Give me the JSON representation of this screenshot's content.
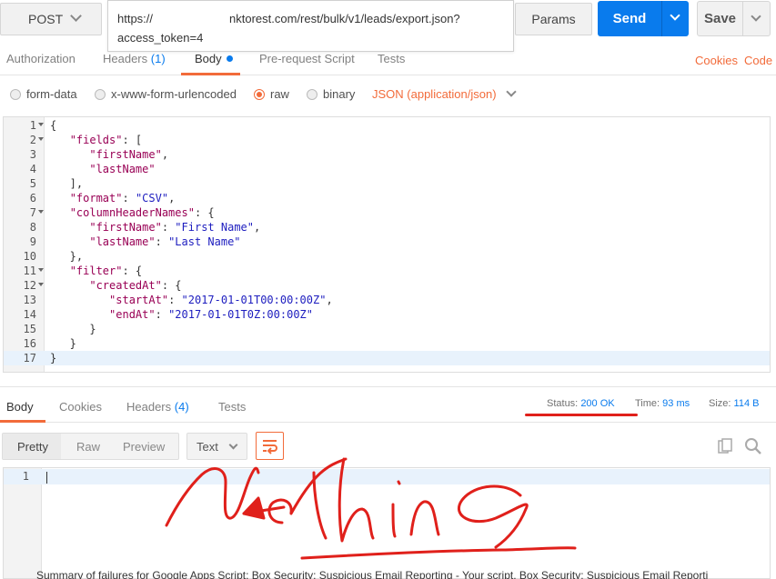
{
  "request": {
    "method": "POST",
    "url_line1_prefix": "https://",
    "url_line1_suffix": "nktorest.com/rest/bulk/v1/leads/export.json?",
    "url_line2": "access_token=4",
    "params_label": "Params",
    "send_label": "Send",
    "save_label": "Save"
  },
  "request_tabs": {
    "authorization": "Authorization",
    "headers": "Headers",
    "headers_count": "(1)",
    "body": "Body",
    "prerequest": "Pre-request Script",
    "tests": "Tests",
    "cookies": "Cookies",
    "code": "Code"
  },
  "body_types": {
    "form_data": "form-data",
    "urlencoded": "x-www-form-urlencoded",
    "raw": "raw",
    "binary": "binary",
    "content_type": "JSON (application/json)",
    "selected": "raw"
  },
  "code_lines": [
    {
      "n": "1",
      "fold": true,
      "parts": [
        [
          "p",
          "{"
        ]
      ]
    },
    {
      "n": "2",
      "fold": true,
      "parts": [
        [
          "p",
          "   "
        ],
        [
          "k",
          "\"fields\""
        ],
        [
          "p",
          ": ["
        ]
      ]
    },
    {
      "n": "3",
      "fold": false,
      "parts": [
        [
          "p",
          "      "
        ],
        [
          "k",
          "\"firstName\""
        ],
        [
          "p",
          ","
        ]
      ]
    },
    {
      "n": "4",
      "fold": false,
      "parts": [
        [
          "p",
          "      "
        ],
        [
          "k",
          "\"lastName\""
        ]
      ]
    },
    {
      "n": "5",
      "fold": false,
      "parts": [
        [
          "p",
          "   ],"
        ]
      ]
    },
    {
      "n": "6",
      "fold": false,
      "parts": [
        [
          "p",
          "   "
        ],
        [
          "k",
          "\"format\""
        ],
        [
          "p",
          ": "
        ],
        [
          "s",
          "\"CSV\""
        ],
        [
          "p",
          ","
        ]
      ]
    },
    {
      "n": "7",
      "fold": true,
      "parts": [
        [
          "p",
          "   "
        ],
        [
          "k",
          "\"columnHeaderNames\""
        ],
        [
          "p",
          ": {"
        ]
      ]
    },
    {
      "n": "8",
      "fold": false,
      "parts": [
        [
          "p",
          "      "
        ],
        [
          "k",
          "\"firstName\""
        ],
        [
          "p",
          ": "
        ],
        [
          "s",
          "\"First Name\""
        ],
        [
          "p",
          ","
        ]
      ]
    },
    {
      "n": "9",
      "fold": false,
      "parts": [
        [
          "p",
          "      "
        ],
        [
          "k",
          "\"lastName\""
        ],
        [
          "p",
          ": "
        ],
        [
          "s",
          "\"Last Name\""
        ]
      ]
    },
    {
      "n": "10",
      "fold": false,
      "parts": [
        [
          "p",
          "   },"
        ]
      ]
    },
    {
      "n": "11",
      "fold": true,
      "parts": [
        [
          "p",
          "   "
        ],
        [
          "k",
          "\"filter\""
        ],
        [
          "p",
          ": {"
        ]
      ]
    },
    {
      "n": "12",
      "fold": true,
      "parts": [
        [
          "p",
          "      "
        ],
        [
          "k",
          "\"createdAt\""
        ],
        [
          "p",
          ": {"
        ]
      ]
    },
    {
      "n": "13",
      "fold": false,
      "parts": [
        [
          "p",
          "         "
        ],
        [
          "k",
          "\"startAt\""
        ],
        [
          "p",
          ": "
        ],
        [
          "s",
          "\"2017-01-01T00:00:00Z\""
        ],
        [
          "p",
          ","
        ]
      ]
    },
    {
      "n": "14",
      "fold": false,
      "parts": [
        [
          "p",
          "         "
        ],
        [
          "k",
          "\"endAt\""
        ],
        [
          "p",
          ": "
        ],
        [
          "s",
          "\"2017-01-01T0Z:00:00Z\""
        ]
      ]
    },
    {
      "n": "15",
      "fold": false,
      "parts": [
        [
          "p",
          "      }"
        ]
      ]
    },
    {
      "n": "16",
      "fold": false,
      "parts": [
        [
          "p",
          "   }"
        ]
      ]
    },
    {
      "n": "17",
      "fold": false,
      "parts": [
        [
          "p",
          "}"
        ]
      ],
      "highlight": true
    }
  ],
  "response_tabs": {
    "body": "Body",
    "cookies": "Cookies",
    "headers": "Headers",
    "headers_count": "(4)",
    "tests": "Tests"
  },
  "response_status": {
    "status_label": "Status:",
    "status_value": "200 OK",
    "time_label": "Time:",
    "time_value": "93 ms",
    "size_label": "Size:",
    "size_value": "114 B"
  },
  "response_toolbar": {
    "pretty": "Pretty",
    "raw": "Raw",
    "preview": "Preview",
    "format": "Text"
  },
  "response_body": {
    "line_number": "1"
  },
  "annotation": {
    "handwritten_text": "Nothing",
    "color": "#e0201b"
  },
  "footer_text": "Summary of failures for Google Apps Script: Box Security: Suspicious Email Reporting - Your script, Box Security: Suspicious Email Reporti",
  "colors": {
    "accent": "#f26b3a",
    "primary": "#097bed",
    "annotation": "#e0201b"
  }
}
